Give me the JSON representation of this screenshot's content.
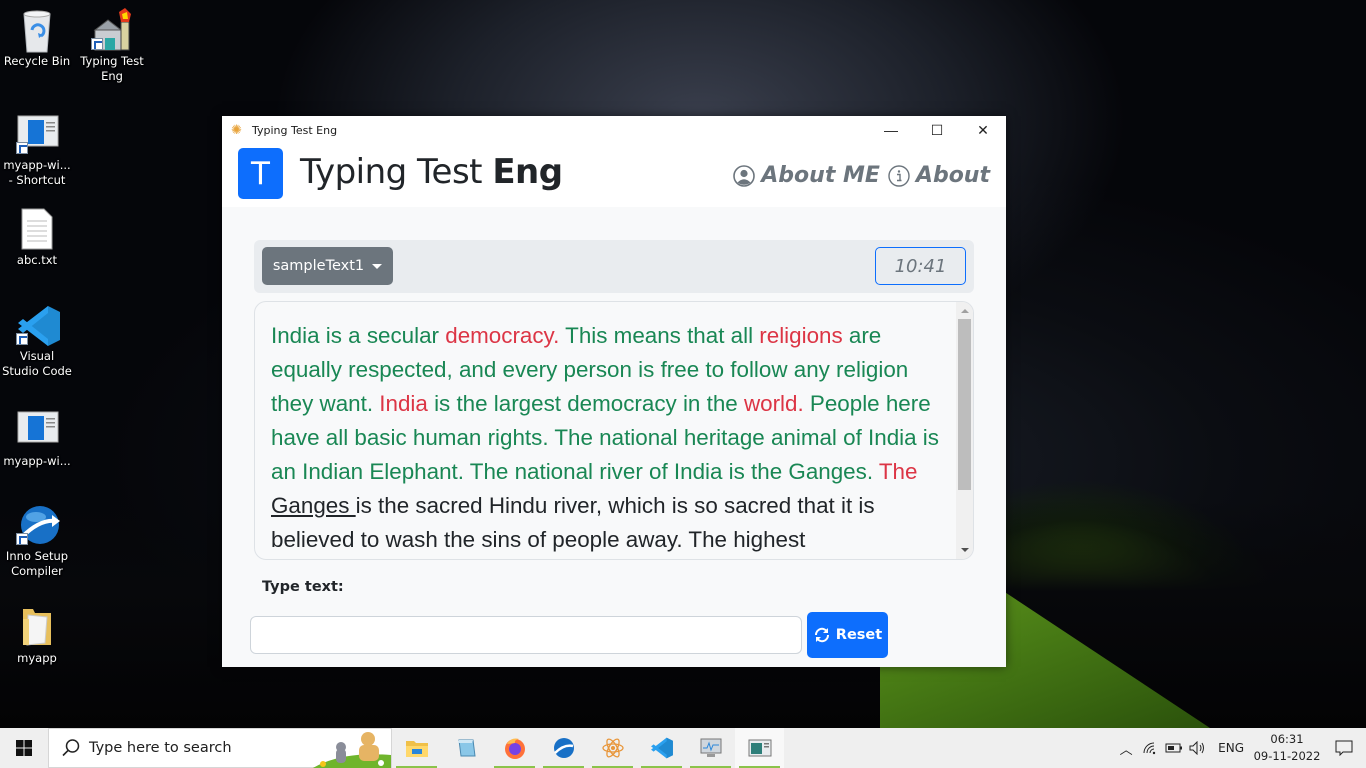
{
  "desktop": {
    "icons": [
      {
        "label": "Recycle Bin",
        "icon": "recycle-bin-icon"
      },
      {
        "label": "Typing Test Eng",
        "icon": "typing-test-app-icon"
      },
      {
        "label": "myapp-wi... - Shortcut",
        "icon": "app-window-icon"
      },
      {
        "label": "abc.txt",
        "icon": "text-file-icon"
      },
      {
        "label": "Visual Studio Code",
        "icon": "vscode-icon"
      },
      {
        "label": "myapp-wi...",
        "icon": "app-window-icon"
      },
      {
        "label": "Inno Setup Compiler",
        "icon": "inno-setup-icon"
      },
      {
        "label": "myapp",
        "icon": "folder-icon"
      }
    ]
  },
  "window": {
    "title": "Typing Test Eng",
    "controls": {
      "minimize": "—",
      "maximize": "☐",
      "close": "✕"
    }
  },
  "header": {
    "logo_letter": "T",
    "brand_regular": "Typing Test ",
    "brand_bold": "Eng",
    "nav": [
      {
        "label": "About ME",
        "icon": "person-circle-icon"
      },
      {
        "label": "About",
        "icon": "info-circle-icon"
      }
    ]
  },
  "toolbar": {
    "sample_select": "sampleText1",
    "timer": "10:41"
  },
  "passage": {
    "segments": [
      {
        "text": "India is a secular ",
        "status": "correct"
      },
      {
        "text": "democracy.",
        "status": "wrong"
      },
      {
        "text": " This means that all ",
        "status": "correct"
      },
      {
        "text": "religions",
        "status": "wrong"
      },
      {
        "text": " are equally respected, and every person is free to follow any religion they want. ",
        "status": "correct"
      },
      {
        "text": "India",
        "status": "wrong"
      },
      {
        "text": " is the largest democracy in the ",
        "status": "correct"
      },
      {
        "text": "world.",
        "status": "wrong"
      },
      {
        "text": " People here have all basic human rights. The national heritage animal of India is an Indian Elephant. The national river of India is the Ganges. ",
        "status": "correct"
      },
      {
        "text": "The",
        "status": "wrong"
      },
      {
        "text": " ",
        "status": "pending"
      },
      {
        "text": "Ganges ",
        "status": "current"
      },
      {
        "text": "is the sacred Hindu river, which is so sacred that it is believed to wash the sins of people away. The highest",
        "status": "pending"
      }
    ]
  },
  "typing": {
    "label": "Type text:",
    "input_value": "",
    "input_placeholder": "",
    "reset_label": "Reset"
  },
  "colors": {
    "primary": "#0d6efd",
    "secondary": "#6c757d",
    "correct": "#198754",
    "wrong": "#dc3545"
  },
  "taskbar": {
    "search_placeholder": "Type here to search",
    "apps": [
      {
        "name": "file-explorer",
        "running": true
      },
      {
        "name": "notepad",
        "running": false
      },
      {
        "name": "firefox",
        "running": true
      },
      {
        "name": "inno-setup",
        "running": true
      },
      {
        "name": "atom",
        "running": true
      },
      {
        "name": "vscode",
        "running": true
      },
      {
        "name": "performance-monitor",
        "running": true
      },
      {
        "name": "typing-test-window",
        "running": true,
        "active": true
      }
    ],
    "tray": {
      "language": "ENG",
      "time": "06:31",
      "date": "09-11-2022"
    }
  }
}
